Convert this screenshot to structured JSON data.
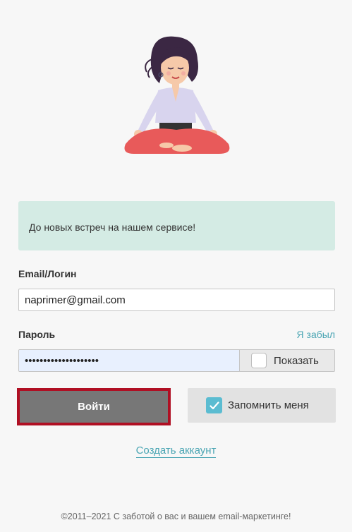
{
  "illustration": {
    "icon": "meditating-woman-illustration"
  },
  "notice": {
    "text": "До новых встреч на нашем сервисе!"
  },
  "form": {
    "email_label": "Email/Логин",
    "email_value": "naprimer@gmail.com",
    "password_label": "Пароль",
    "forgot_label": "Я забыл",
    "password_value": "••••••••••••••••••••",
    "show_label": "Показать",
    "login_label": "Войти",
    "remember_label": "Запомнить меня",
    "remember_checked": true
  },
  "create_account": {
    "label": "Создать аккаунт"
  },
  "footer": {
    "text": "©2011–2021 С заботой о вас и вашем email-маркетинге!"
  },
  "colors": {
    "notice_bg": "#d4ebe4",
    "link": "#4aa5b3",
    "login_border": "#b00f23",
    "checkbox": "#5bbcd1"
  }
}
